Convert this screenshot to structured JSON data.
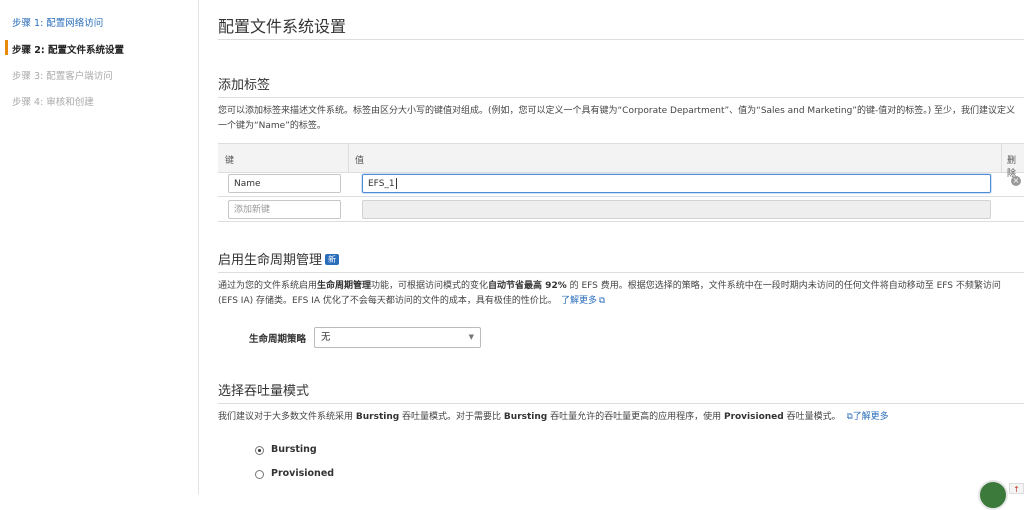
{
  "sidebar": {
    "steps": [
      {
        "label": "步骤 1: 配置网络访问",
        "state": "link"
      },
      {
        "label": "步骤 2: 配置文件系统设置",
        "state": "active"
      },
      {
        "label": "步骤 3: 配置客户端访问",
        "state": "disabled"
      },
      {
        "label": "步骤 4: 审核和创建",
        "state": "disabled"
      }
    ]
  },
  "page": {
    "title": "配置文件系统设置"
  },
  "tags": {
    "title": "添加标签",
    "desc_line1": "您可以添加标签来描述文件系统。标签由区分大小写的键值对组成。(例如，您可以定义一个具有键为“Corporate Department”、值为“Sales and Marketing”的键-值对的标签。) 至少，我们建议定义",
    "desc_line2": "一个键为“Name”的标签。",
    "columns": {
      "key": "键",
      "value": "值",
      "remove": "删除"
    },
    "rows": [
      {
        "key": "Name",
        "value": "EFS_1"
      }
    ],
    "new_key_placeholder": "添加新键"
  },
  "lifecycle": {
    "title": "启用生命周期管理",
    "badge": "新",
    "desc_part1": "通过为您的文件系统启用",
    "desc_bold1": "生命周期管理",
    "desc_part2": "功能，可根据访问模式的变化",
    "desc_bold2": "自动节省最高 92%",
    "desc_part3": " 的 EFS 费用。根据您选择的策略，文件系统中在一段时期内未访问的任何文件将自动移动至 EFS 不频繁访问",
    "desc_line2": "(EFS IA) 存储类。EFS IA 优化了不会每天都访问的文件的成本，具有极佳的性价比。",
    "learn_more": "了解更多",
    "policy_label": "生命周期策略",
    "policy_value": "无"
  },
  "throughput": {
    "title": "选择吞吐量模式",
    "desc_part1": "我们建议对于大多数文件系统采用 ",
    "desc_bold1": "Bursting",
    "desc_part2": " 吞吐量模式。对于需要比 ",
    "desc_bold2": "Bursting",
    "desc_part3": " 吞吐量允许的吞吐量更高的应用程序，使用 ",
    "desc_bold3": "Provisioned",
    "desc_part4": " 吞吐量模式。",
    "learn_more": "了解更多",
    "options": [
      {
        "label": "Bursting",
        "selected": true
      },
      {
        "label": "Provisioned",
        "selected": false
      }
    ]
  },
  "icons": {
    "remove": "remove-circle-icon",
    "external": "external-link-icon",
    "dropdown": "chevron-down-icon"
  },
  "colors": {
    "link": "#2a6ebb",
    "active_step_bar": "#e8890c",
    "focus_border": "#4e8cd9"
  }
}
